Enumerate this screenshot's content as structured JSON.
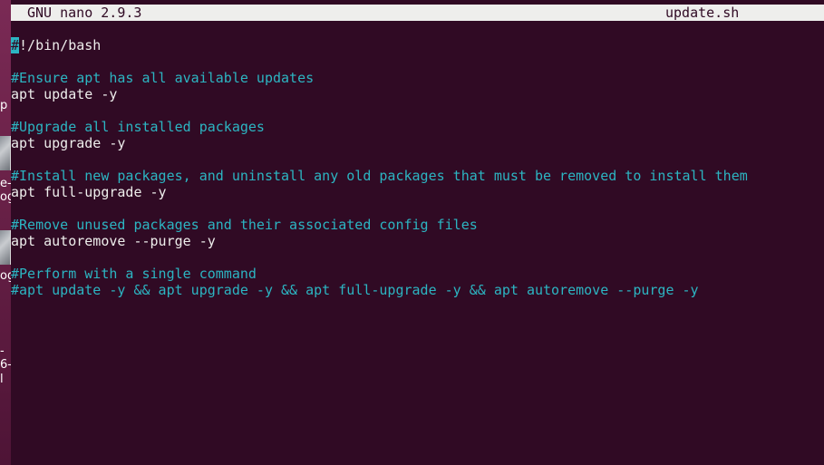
{
  "desktop": {
    "fragments": [
      "p",
      "e-",
      "og",
      "og",
      "-",
      "6-",
      "l"
    ]
  },
  "titlebar": {
    "app": "GNU nano 2.9.3",
    "filename": "update.sh"
  },
  "editor": {
    "lines": [
      {
        "type": "code",
        "text": "#!/bin/bash",
        "cursor": true
      },
      {
        "type": "empty",
        "text": ""
      },
      {
        "type": "comment",
        "text": "#Ensure apt has all available updates"
      },
      {
        "type": "code",
        "text": "apt update -y"
      },
      {
        "type": "empty",
        "text": ""
      },
      {
        "type": "comment",
        "text": "#Upgrade all installed packages"
      },
      {
        "type": "code",
        "text": "apt upgrade -y"
      },
      {
        "type": "empty",
        "text": ""
      },
      {
        "type": "comment",
        "text": "#Install new packages, and uninstall any old packages that must be removed to install them"
      },
      {
        "type": "code",
        "text": "apt full-upgrade -y"
      },
      {
        "type": "empty",
        "text": ""
      },
      {
        "type": "comment",
        "text": "#Remove unused packages and their associated config files"
      },
      {
        "type": "code",
        "text": "apt autoremove --purge -y"
      },
      {
        "type": "empty",
        "text": ""
      },
      {
        "type": "comment",
        "text": "#Perform with a single command"
      },
      {
        "type": "comment",
        "text": "#apt update -y && apt upgrade -y && apt full-upgrade -y && apt autoremove --purge -y"
      }
    ]
  },
  "colors": {
    "background": "#300a24",
    "text": "#eeeeec",
    "comment": "#2cb5c2",
    "titlebar": "#eeeeec"
  }
}
